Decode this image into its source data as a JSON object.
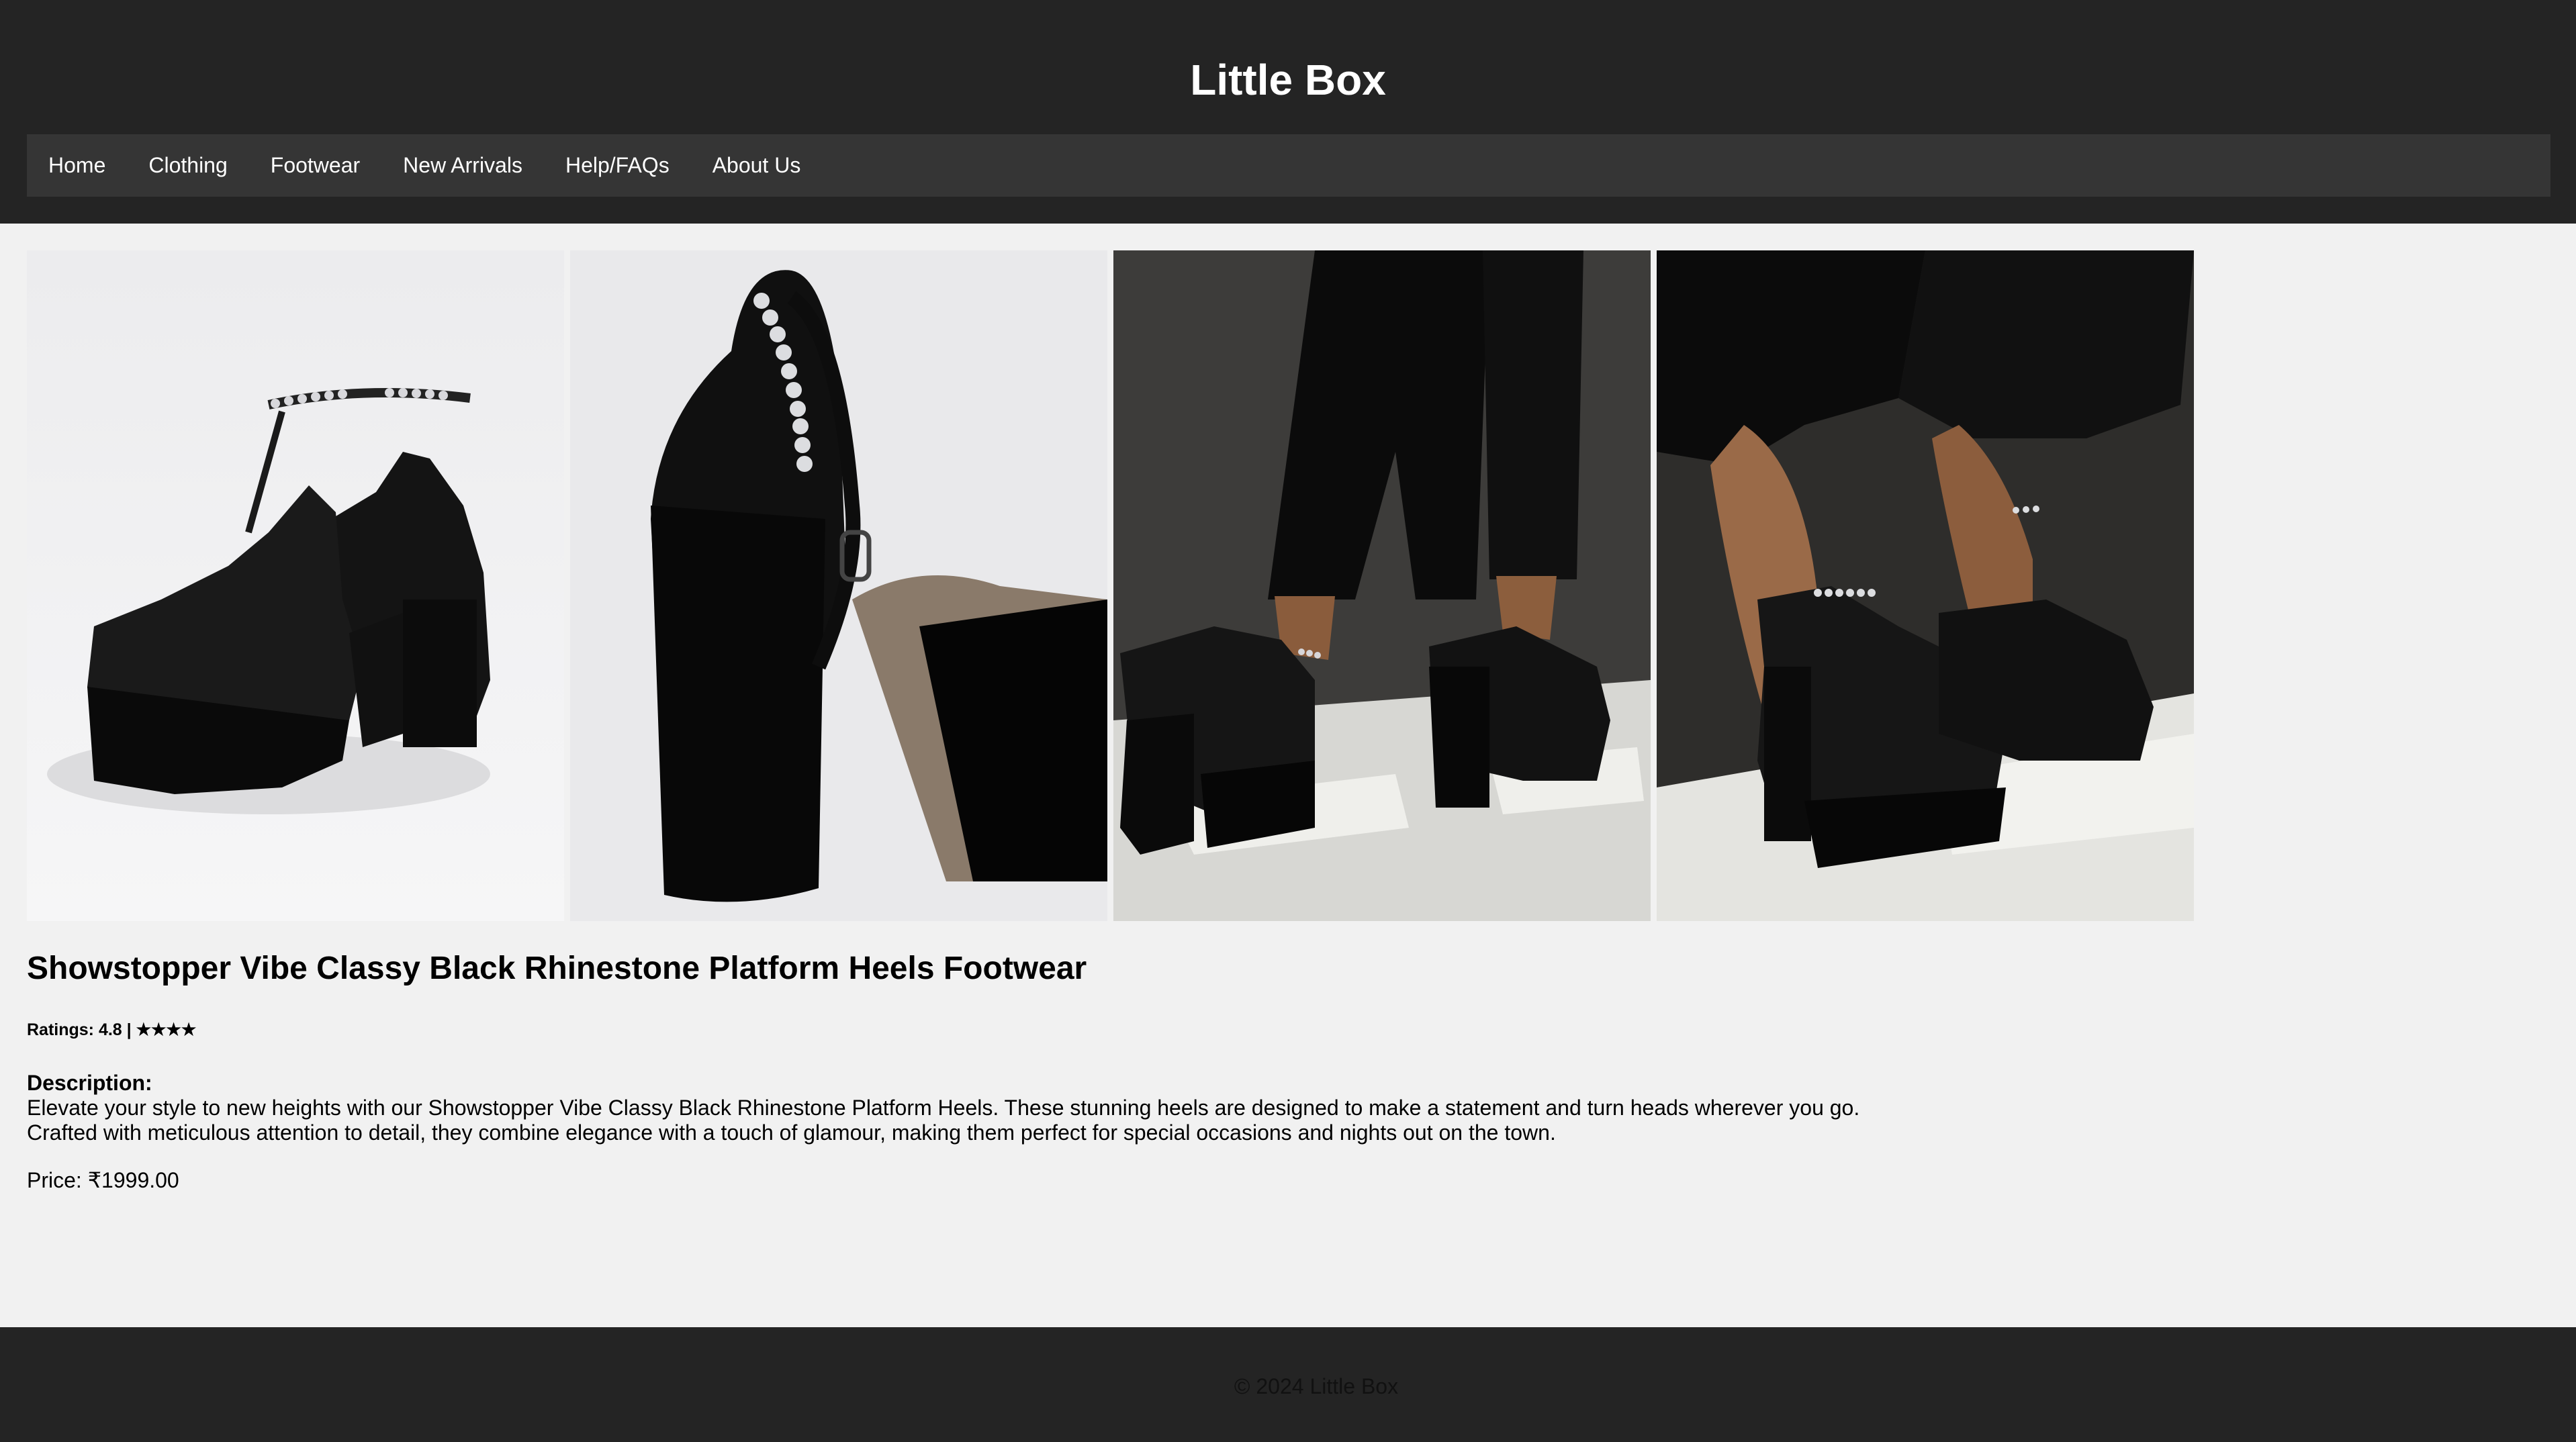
{
  "header": {
    "site_title": "Little Box",
    "nav": [
      "Home",
      "Clothing",
      "Footwear",
      "New Arrivals",
      "Help/FAQs",
      "About Us"
    ]
  },
  "product": {
    "title": "Showstopper Vibe Classy Black Rhinestone Platform Heels Footwear",
    "ratings_text": "Ratings: 4.8 | ★★★★",
    "description_label": "Description:",
    "description_lines": [
      "Elevate your style to new heights with our Showstopper Vibe Classy Black Rhinestone Platform Heels. These stunning heels are designed to make a statement and turn heads wherever you go.",
      "Crafted with meticulous attention to detail, they combine elegance with a touch of glamour, making them perfect for special occasions and nights out on the town."
    ],
    "price_text": "Price: ₹1999.00"
  },
  "footer": {
    "copyright": "© 2024 Little Box"
  },
  "colors": {
    "header_bg": "#242424",
    "nav_bg": "#353535",
    "page_bg": "#f1f1f1",
    "text": "#000000"
  }
}
